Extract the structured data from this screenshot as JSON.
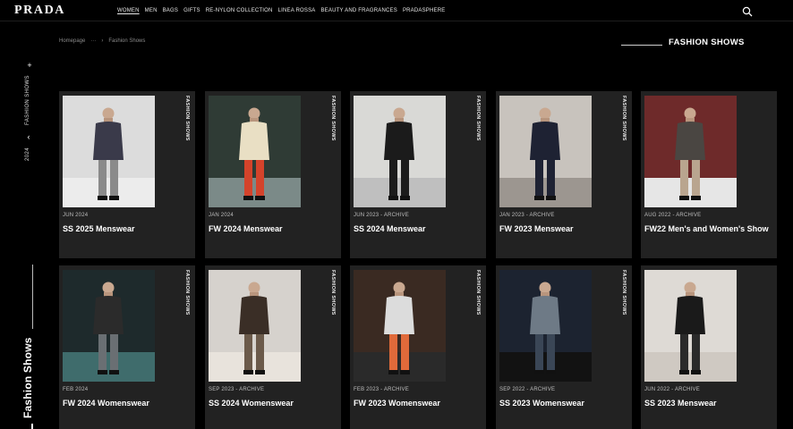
{
  "brand": {
    "logo": "PRADA"
  },
  "nav": {
    "items": [
      {
        "label": "WOMEN"
      },
      {
        "label": "MEN"
      },
      {
        "label": "BAGS"
      },
      {
        "label": "GIFTS"
      },
      {
        "label": "RE-NYLON COLLECTION"
      },
      {
        "label": "LINEA ROSSA"
      },
      {
        "label": "BEAUTY AND FRAGRANCES"
      },
      {
        "label": "PRADASPHERE"
      }
    ],
    "search_icon": "search-icon"
  },
  "breadcrumb": {
    "home": "Homepage",
    "ellipsis": "···",
    "separator": "›",
    "current": "Fashion Shows"
  },
  "page_title": "FASHION SHOWS",
  "sidebar": {
    "plus": "+",
    "section": "FASHION SHOWS",
    "chevron": "‹",
    "year": "2024",
    "big_title": "Fashion Shows"
  },
  "cards": [
    {
      "label": "FASHION SHOWS",
      "date": "JUN 2024",
      "name": "SS 2025 Menswear",
      "bg": "#dcdcdc",
      "floor": "#ececec",
      "outfit": "#3a3a4a",
      "accent": "#8a8a8a"
    },
    {
      "label": "FASHION SHOWS",
      "date": "JAN 2024",
      "name": "FW 2024 Menswear",
      "bg": "#2f3b35",
      "floor": "#7b8a88",
      "outfit": "#e9dfc4",
      "accent": "#d4432b"
    },
    {
      "label": "FASHION SHOWS",
      "date": "JUN 2023 - ARCHIVE",
      "name": "SS 2024 Menswear",
      "bg": "#d9d9d6",
      "floor": "#bfbfbf",
      "outfit": "#1b1b1b",
      "accent": "#1b1b1b"
    },
    {
      "label": "FASHION SHOWS",
      "date": "JAN 2023 - ARCHIVE",
      "name": "FW 2023 Menswear",
      "bg": "#c8c3bd",
      "floor": "#9c9690",
      "outfit": "#1e2233",
      "accent": "#1e2233"
    },
    {
      "label": "",
      "date": "AUG 2022 - ARCHIVE",
      "name": "FW22 Men's and Women's Show",
      "bg": "#6e2a2a",
      "floor": "#e6e6e6",
      "outfit": "#4a4642",
      "accent": "#b9a58f"
    },
    {
      "label": "FASHION SHOWS",
      "date": "FEB 2024",
      "name": "FW 2024 Womenswear",
      "bg": "#1e2a2c",
      "floor": "#3f6c6c",
      "outfit": "#2b2b2b",
      "accent": "#6a6f73"
    },
    {
      "label": "FASHION SHOWS",
      "date": "SEP 2023 - ARCHIVE",
      "name": "SS 2024 Womenswear",
      "bg": "#d6d2cd",
      "floor": "#e8e3dc",
      "outfit": "#3a2e26",
      "accent": "#6b5a4a"
    },
    {
      "label": "FASHION SHOWS",
      "date": "FEB 2023 - ARCHIVE",
      "name": "FW 2023 Womenswear",
      "bg": "#3a2a22",
      "floor": "#2a2a2a",
      "outfit": "#dcdcdc",
      "accent": "#e06a3a"
    },
    {
      "label": "FASHION SHOWS",
      "date": "SEP 2022 - ARCHIVE",
      "name": "SS 2023 Womenswear",
      "bg": "#1c2330",
      "floor": "#121212",
      "outfit": "#6e7a86",
      "accent": "#3a4656"
    },
    {
      "label": "",
      "date": "JUN 2022 - ARCHIVE",
      "name": "SS 2023 Menswear",
      "bg": "#dedad5",
      "floor": "#cfc9c2",
      "outfit": "#1a1a1a",
      "accent": "#2a2a2a"
    }
  ]
}
